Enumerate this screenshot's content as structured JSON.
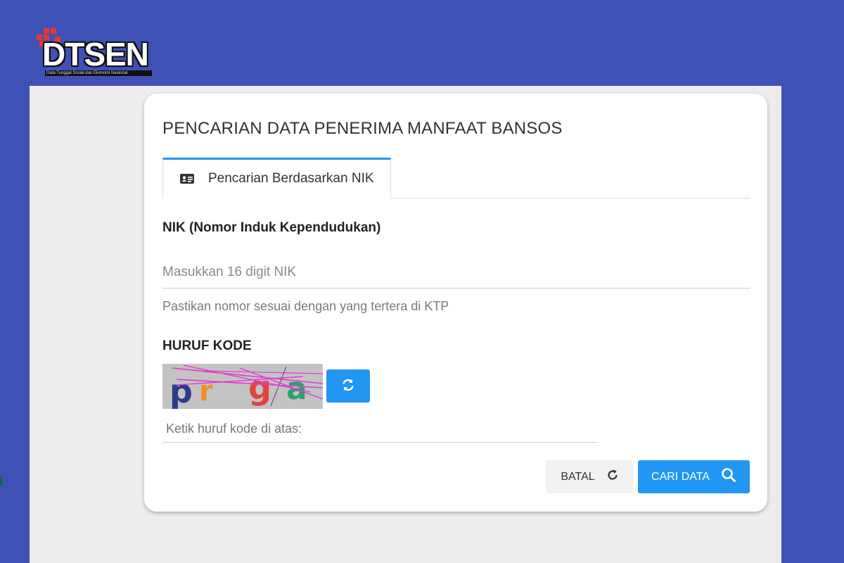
{
  "logo": {
    "text": "DTSEN",
    "subtitle": "Data Tunggal Sosial dan Ekonomi Nasional"
  },
  "form": {
    "title": "PENCARIAN DATA PENERIMA MANFAAT BANSOS",
    "tab_label": "Pencarian Berdasarkan NIK",
    "nik_label": "NIK (Nomor Induk Kependudukan)",
    "nik_placeholder": "Masukkan 16 digit NIK",
    "nik_hint": "Pastikan nomor sesuai dengan yang tertera di KTP",
    "kode_label": "HURUF KODE",
    "captcha_text": "prga",
    "kode_placeholder": "Ketik huruf kode di atas:",
    "cancel_label": "BATAL",
    "search_label": "CARI DATA"
  },
  "icons": {
    "tab": "id-card-icon",
    "captcha_refresh": "refresh-icon",
    "cancel": "reload-icon",
    "search": "search-icon"
  },
  "colors": {
    "background": "#3f51b5",
    "accent": "#2196f3",
    "logo_red": "#e53935"
  }
}
